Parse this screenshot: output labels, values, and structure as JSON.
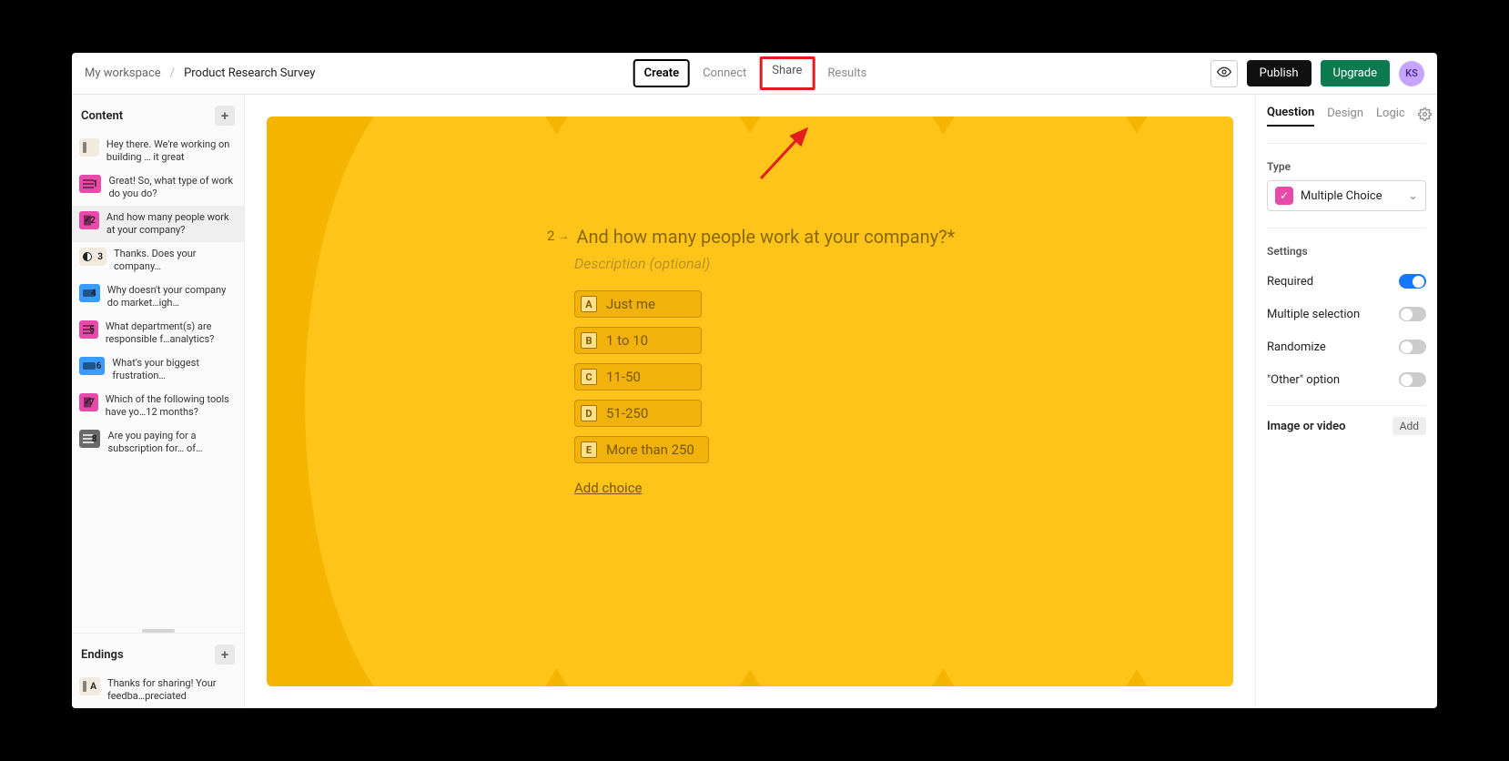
{
  "breadcrumb": {
    "workspace": "My workspace",
    "sep": "/",
    "current": "Product Research Survey"
  },
  "tabs": {
    "create": "Create",
    "connect": "Connect",
    "share": "Share",
    "results": "Results"
  },
  "toolbar": {
    "publish": "Publish",
    "upgrade": "Upgrade",
    "avatar": "KS"
  },
  "sidebar": {
    "content_header": "Content",
    "endings_header": "Endings",
    "items": [
      {
        "num": "",
        "label": "Hey there. We're working on building … it great"
      },
      {
        "num": "1",
        "label": "Great! So, what type of work do you do?"
      },
      {
        "num": "2",
        "label": "And how many people work at your company?"
      },
      {
        "num": "3",
        "label": "Thanks. Does your company…"
      },
      {
        "num": "4",
        "label": "Why doesn't your company do market…igh…"
      },
      {
        "num": "5",
        "label": "What department(s) are responsible f…analytics?"
      },
      {
        "num": "6",
        "label": "What's your biggest frustration…"
      },
      {
        "num": "7",
        "label": "Which of the following tools have yo…12 months?"
      },
      {
        "num": "8",
        "label": "Are you paying for a subscription for… of…"
      }
    ],
    "endings": [
      {
        "num": "A",
        "label": "Thanks for sharing! Your feedba…preciated"
      }
    ]
  },
  "question": {
    "number": "2",
    "title": "And how many people work at your company?*",
    "desc_placeholder": "Description (optional)",
    "choices": [
      {
        "key": "A",
        "label": "Just me"
      },
      {
        "key": "B",
        "label": "1 to 10"
      },
      {
        "key": "C",
        "label": "11-50"
      },
      {
        "key": "D",
        "label": "51-250"
      },
      {
        "key": "E",
        "label": "More than 250"
      }
    ],
    "add_choice": "Add choice"
  },
  "rpanel": {
    "tabs": {
      "question": "Question",
      "design": "Design",
      "logic": "Logic"
    },
    "type_label": "Type",
    "type_value": "Multiple Choice",
    "settings_label": "Settings",
    "settings": {
      "required": "Required",
      "multiple": "Multiple selection",
      "randomize": "Randomize",
      "other": "\"Other\" option"
    },
    "media_label": "Image or video",
    "add": "Add"
  }
}
